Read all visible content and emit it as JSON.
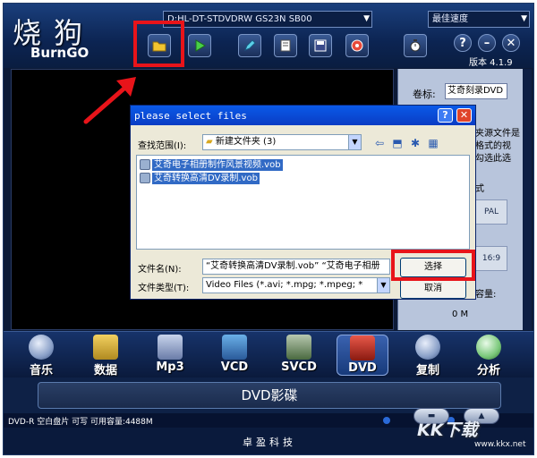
{
  "app": {
    "logo_cn": "烧狗",
    "logo_en": "BurnGO",
    "version": "版本 4.1.9",
    "drive": "D:HL-DT-STDVDRW GS23N  SB00",
    "speed": "最佳速度",
    "toolbar": {
      "help": "?",
      "minimize": "–",
      "close": "✕"
    }
  },
  "right_panel": {
    "title_label": "卷标:",
    "title_value": "艾奇刻录DVD",
    "text_lines": [
      "夹源文件是",
      "格式的视",
      "勾选此选"
    ],
    "format_label": "式",
    "pal_button": "PAL",
    "ratio_button": "16:9",
    "capacity_label": "容量:",
    "capacity_value": "0 M"
  },
  "dialog": {
    "title": "please select files",
    "help": "?",
    "close": "✕",
    "look_in_label": "查找范围(I):",
    "look_in_value": "新建文件夹 (3)",
    "files": [
      "艾奇电子相册制作风景视频.vob",
      "艾奇转换高清DV录制.vob"
    ],
    "filename_label": "文件名(N):",
    "filename_value": "“艾奇转换高清DV录制.vob” “艾奇电子相册",
    "filetype_label": "文件类型(T):",
    "filetype_value": "Video Files (*.avi; *.mpg; *.mpeg; *",
    "select_button": "选择",
    "cancel_button": "取消"
  },
  "nav": [
    {
      "label": "音乐"
    },
    {
      "label": "数据"
    },
    {
      "label": "Mp3"
    },
    {
      "label": "VCD"
    },
    {
      "label": "SVCD"
    },
    {
      "label": "DVD"
    },
    {
      "label": "复制"
    },
    {
      "label": "分析"
    }
  ],
  "disc": {
    "label": "DVD影碟"
  },
  "status": {
    "text": "DVD-R 空白盘片 可写 可用容量:4488M"
  },
  "footer": {
    "company": "卓盈科技",
    "watermark": "KK下载",
    "watermark_url": "www.kkx.net"
  },
  "colors": {
    "highlight": "#e8141a",
    "title_bar": "#0a5ae8",
    "app_bg": "#0c1a36"
  }
}
